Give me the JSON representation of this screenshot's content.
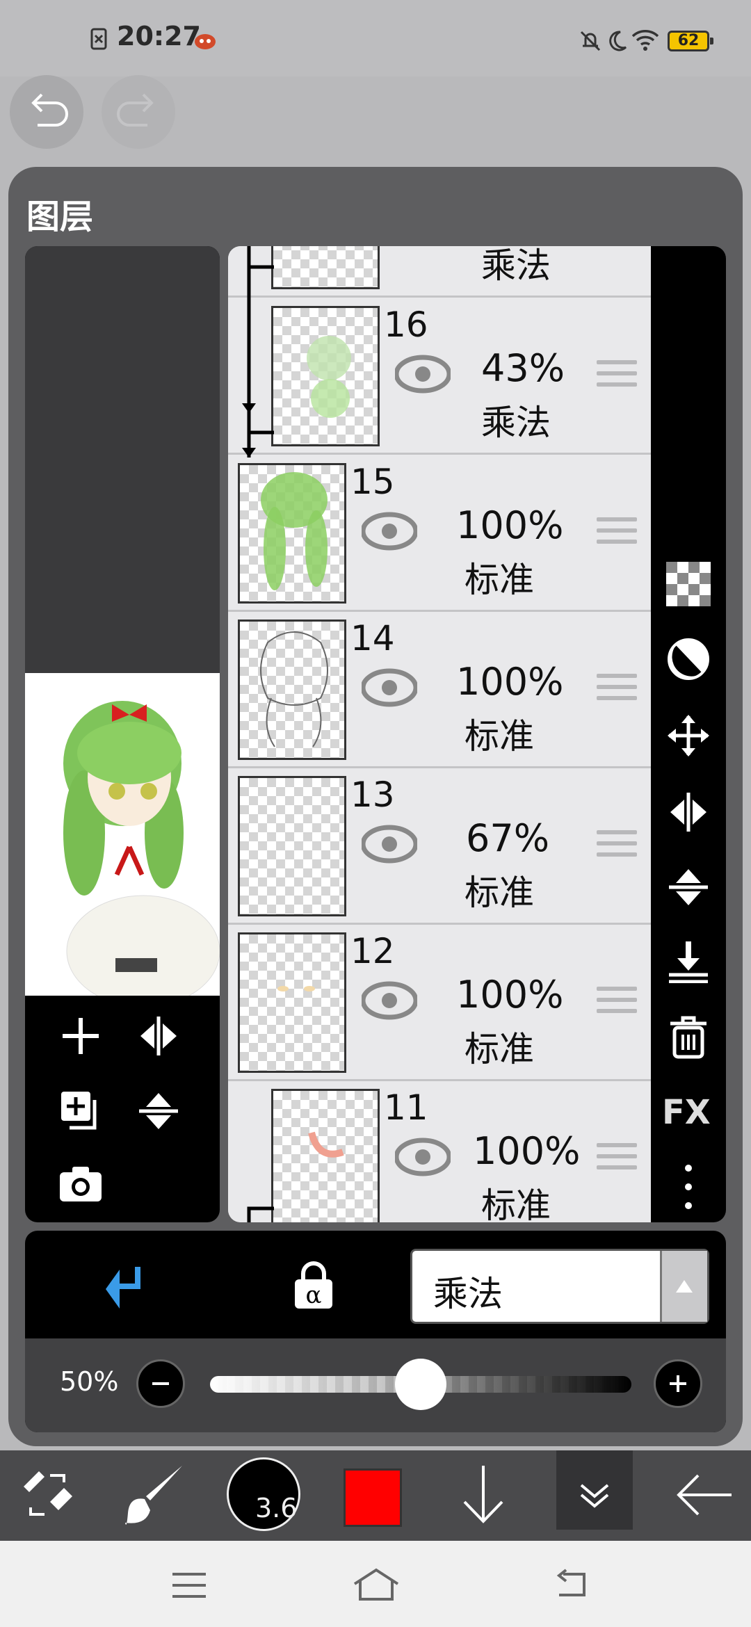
{
  "status_bar": {
    "time": "20:27",
    "battery": "62"
  },
  "panel": {
    "title": "图层"
  },
  "layers": [
    {
      "number": "",
      "opacity": "",
      "blend": "乘法",
      "indent": true
    },
    {
      "number": "16",
      "opacity": "43%",
      "blend": "乘法",
      "indent": true
    },
    {
      "number": "15",
      "opacity": "100%",
      "blend": "标准",
      "indent": false
    },
    {
      "number": "14",
      "opacity": "100%",
      "blend": "标准",
      "indent": false
    },
    {
      "number": "13",
      "opacity": "67%",
      "blend": "标准",
      "indent": false
    },
    {
      "number": "12",
      "opacity": "100%",
      "blend": "标准",
      "indent": false
    },
    {
      "number": "11",
      "opacity": "100%",
      "blend": "标准",
      "indent": true
    }
  ],
  "right_toolbar": {
    "fx_label": "FX"
  },
  "blend_mode": {
    "selected": "乘法"
  },
  "opacity": {
    "label": "50%",
    "value": 0.5
  },
  "brush": {
    "size_label": "3.6",
    "color": "#ff0000"
  },
  "icons": {
    "undo": "undo-icon",
    "redo": "redo-icon",
    "add_layer": "plus-icon",
    "flip_h": "flip-horizontal-icon",
    "duplicate": "duplicate-layer-icon",
    "flip_v": "flip-vertical-icon",
    "camera": "camera-icon",
    "clip": "clipping-arrow-icon",
    "alpha_lock": "alpha-lock-icon"
  }
}
